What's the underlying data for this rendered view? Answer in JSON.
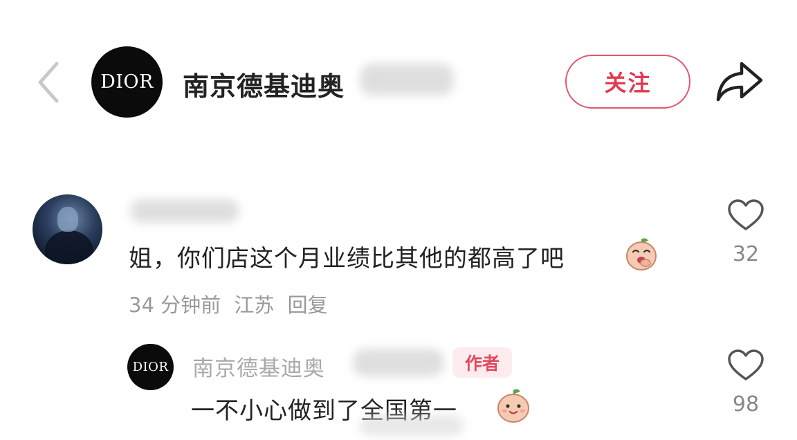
{
  "header": {
    "logo_text": "DIOR",
    "title": "南京德基迪奥",
    "follow_label": "关注"
  },
  "comment": {
    "text": "姐，你们店这个月业绩比其他的都高了吧",
    "time": "34 分钟前",
    "location": "江苏",
    "reply_label": "回复",
    "likes": "32"
  },
  "reply": {
    "logo_text": "DIOR",
    "name": "南京德基迪奥",
    "badge": "作者",
    "text": "一不小心做到了全国第一",
    "likes": "98"
  },
  "icons": {
    "back": "chevron-left-icon",
    "share": "share-arrow-icon",
    "like": "heart-outline-icon",
    "emoji_1": "covering-mouth-laugh-emoji",
    "emoji_2": "shy-smile-emoji"
  },
  "colors": {
    "accent": "#e23a50",
    "badge_bg": "#fdecee",
    "muted": "#999999"
  }
}
